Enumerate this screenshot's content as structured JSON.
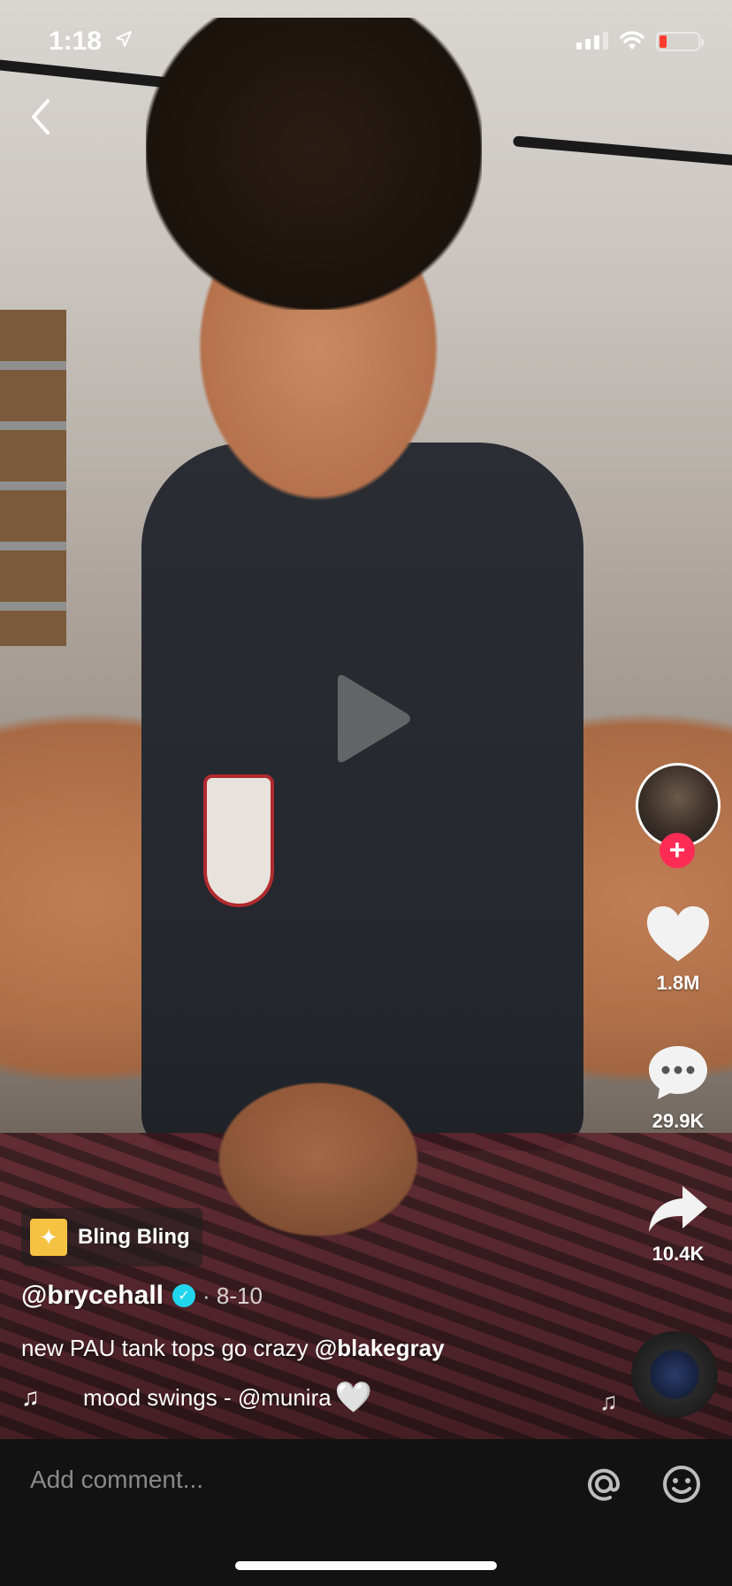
{
  "status_bar": {
    "time": "1:18",
    "location_icon": "location-arrow-icon",
    "signal_icon": "cellular-signal-icon",
    "wifi_icon": "wifi-icon",
    "battery_icon": "battery-low-icon",
    "battery_color": "#ff3b30"
  },
  "nav": {
    "back_icon": "chevron-left-icon"
  },
  "video": {
    "play_icon": "play-icon"
  },
  "actions": {
    "follow_icon": "plus-icon",
    "like_icon": "heart-icon",
    "likes": "1.8M",
    "comment_icon": "speech-bubble-icon",
    "comments": "29.9K",
    "share_icon": "share-arrow-icon",
    "shares": "10.4K",
    "accent": "#fe2c55"
  },
  "effect": {
    "icon": "sparkle-icon",
    "label": "Bling Bling"
  },
  "post": {
    "author": "@brycehall",
    "verified_icon": "verified-check-icon",
    "date": "· 8-10",
    "caption_text": "new PAU tank tops go crazy ",
    "caption_mention": "@blakegray",
    "music_icon": "music-note-icon",
    "music": "mood swings - @munira",
    "music_heart": "🤍"
  },
  "comment_bar": {
    "placeholder": "Add comment...",
    "mention_icon": "at-icon",
    "emoji_icon": "emoji-icon"
  }
}
